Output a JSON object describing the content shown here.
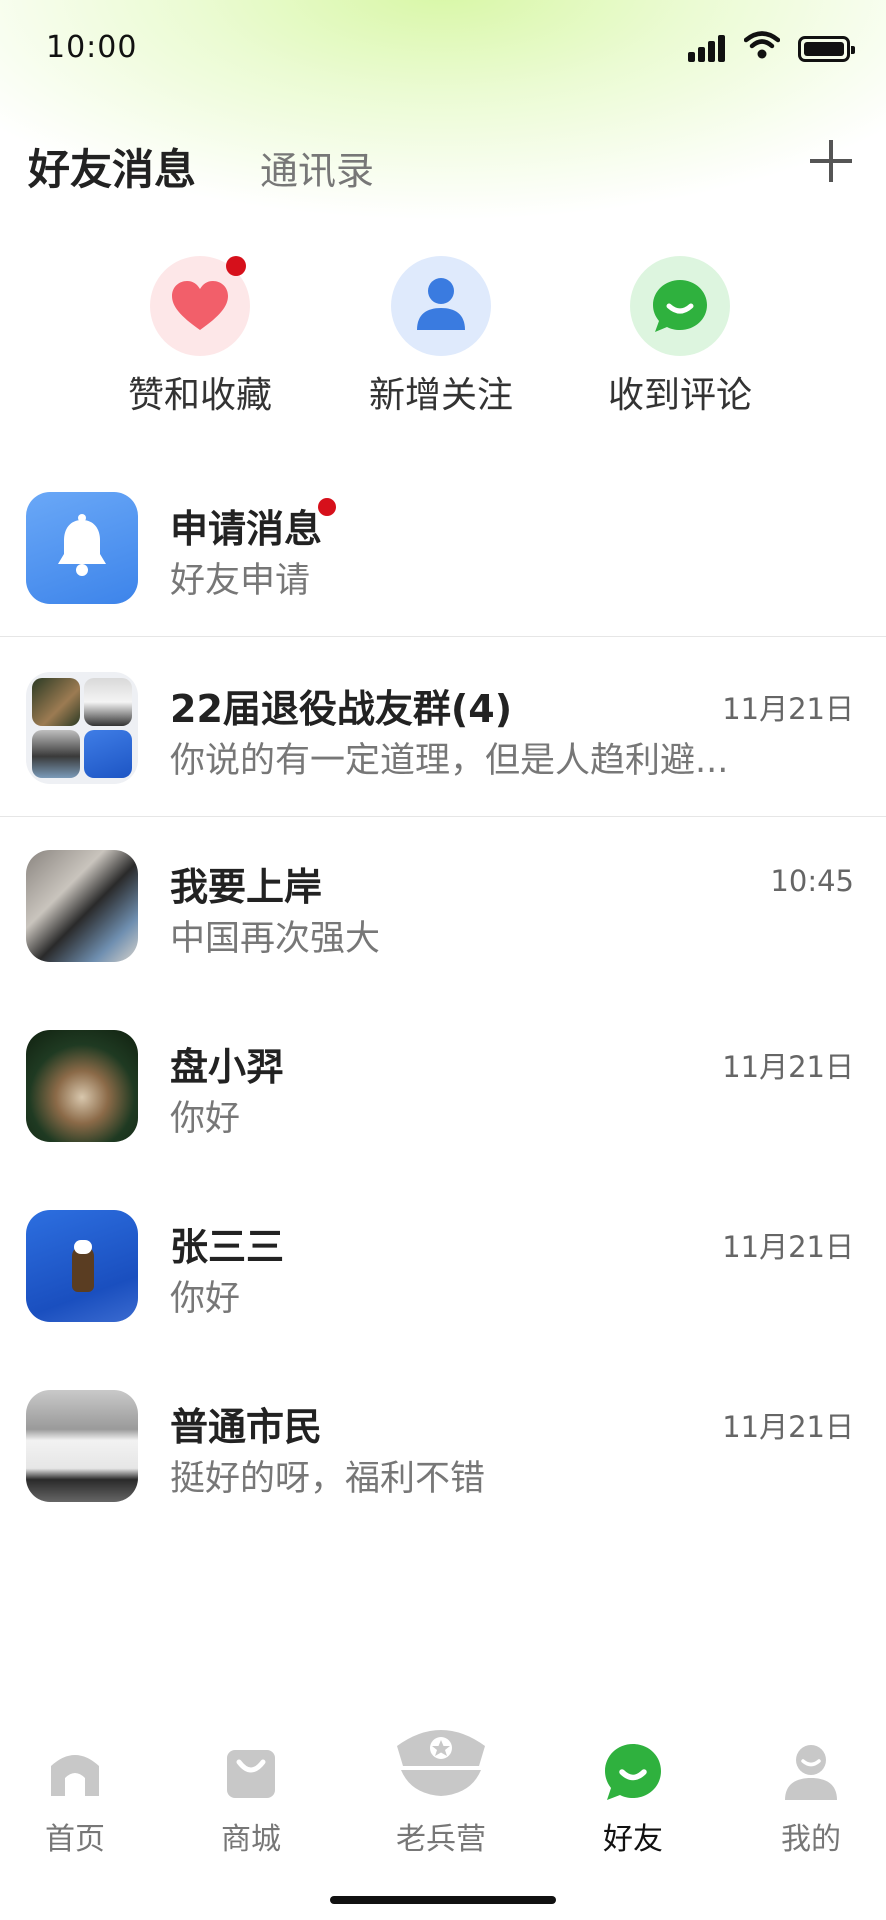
{
  "status_bar": {
    "time": "10:00"
  },
  "header": {
    "title": "好友消息",
    "contacts_tab": "通讯录"
  },
  "quick_actions": [
    {
      "label": "赞和收藏",
      "icon": "heart-icon",
      "color": "#f25f6a",
      "bg": "#fde7e8"
    },
    {
      "label": "新增关注",
      "icon": "person-icon",
      "color": "#3a7be0",
      "bg": "#dfeafc"
    },
    {
      "label": "收到评论",
      "icon": "chat-icon",
      "color": "#2fb13e",
      "bg": "#ddf5df"
    }
  ],
  "messages": [
    {
      "name": "申请消息",
      "preview": "好友申请",
      "time": "",
      "unread": true,
      "avatar": "bell-icon"
    },
    {
      "name": "22届退役战友群(4)",
      "preview": "你说的有一定道理，但是人趋利避...",
      "time": "11月21日",
      "avatar": "group-avatar"
    },
    {
      "name": "我要上岸",
      "preview": "中国再次强大",
      "time": "10:45",
      "avatar": "woman-photo"
    },
    {
      "name": "盘小羿",
      "preview": "你好",
      "time": "11月21日",
      "avatar": "dog-christmas-photo"
    },
    {
      "name": "张三三",
      "preview": "你好",
      "time": "11月21日",
      "avatar": "eagle-photo"
    },
    {
      "name": "普通市民",
      "preview": "挺好的呀，福利不错",
      "time": "11月21日",
      "avatar": "house-photo"
    }
  ],
  "tab_bar": [
    {
      "label": "首页",
      "icon": "home-icon",
      "active": false
    },
    {
      "label": "商城",
      "icon": "shop-bag-icon",
      "active": false
    },
    {
      "label": "老兵营",
      "icon": "police-cap-icon",
      "active": false
    },
    {
      "label": "好友",
      "icon": "chat-icon",
      "active": true
    },
    {
      "label": "我的",
      "icon": "user-icon",
      "active": false
    }
  ],
  "colors": {
    "accent_green": "#2fb13e",
    "unread_dot": "#d6101b",
    "inactive_tab": "#c8c8c8"
  }
}
